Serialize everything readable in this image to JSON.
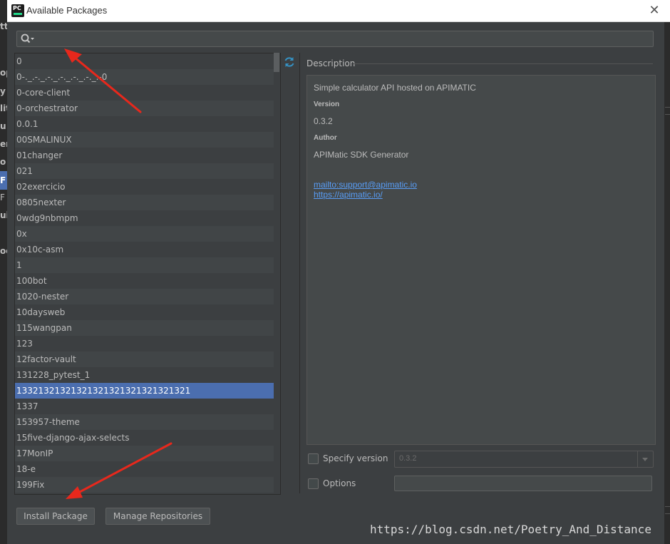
{
  "window": {
    "title": "Available Packages",
    "app_icon_text": "PC",
    "close_glyph": "✕"
  },
  "search": {
    "value": "",
    "placeholder": ""
  },
  "packages": {
    "items": [
      "0",
      "0-._.-._.-._.-._.-._.-._.-0",
      "0-core-client",
      "0-orchestrator",
      "0.0.1",
      "00SMALINUX",
      "01changer",
      "021",
      "02exercicio",
      "0805nexter",
      "0wdg9nbmpm",
      "0x",
      "0x10c-asm",
      "1",
      "100bot",
      "1020-nester",
      "10daysweb",
      "115wangpan",
      "123",
      "12factor-vault",
      "131228_pytest_1",
      "13321321321321321321321321321321",
      "1337",
      "153957-theme",
      "15five-django-ajax-selects",
      "17MonIP",
      "18-e",
      "199Fix"
    ],
    "selected_index": 21
  },
  "description": {
    "section_label": "Description",
    "summary": "Simple calculator API hosted on APIMATIC",
    "version_heading": "Version",
    "version_value": "0.3.2",
    "author_heading": "Author",
    "author_value": "APIMatic SDK Generator",
    "link_email": "mailto:support@apimatic.io",
    "link_url": "https://apimatic.io/"
  },
  "options": {
    "specify_version_label": "Specify version",
    "specify_version_checked": false,
    "version_selected": "0.3.2",
    "options_label": "Options",
    "options_checked": false,
    "options_value": ""
  },
  "buttons": {
    "install": "Install Package",
    "manage": "Manage Repositories"
  },
  "background_ide": {
    "left_fragments": [
      "tt",
      "op",
      "y",
      "lit",
      "u",
      "er",
      "o",
      "F",
      "F",
      "ui",
      "oc"
    ]
  },
  "watermark": "https://blog.csdn.net/Poetry_And_Distance",
  "colors": {
    "selection": "#4b6eaf",
    "link": "#589df6",
    "annotation_arrow": "#e8281c"
  }
}
